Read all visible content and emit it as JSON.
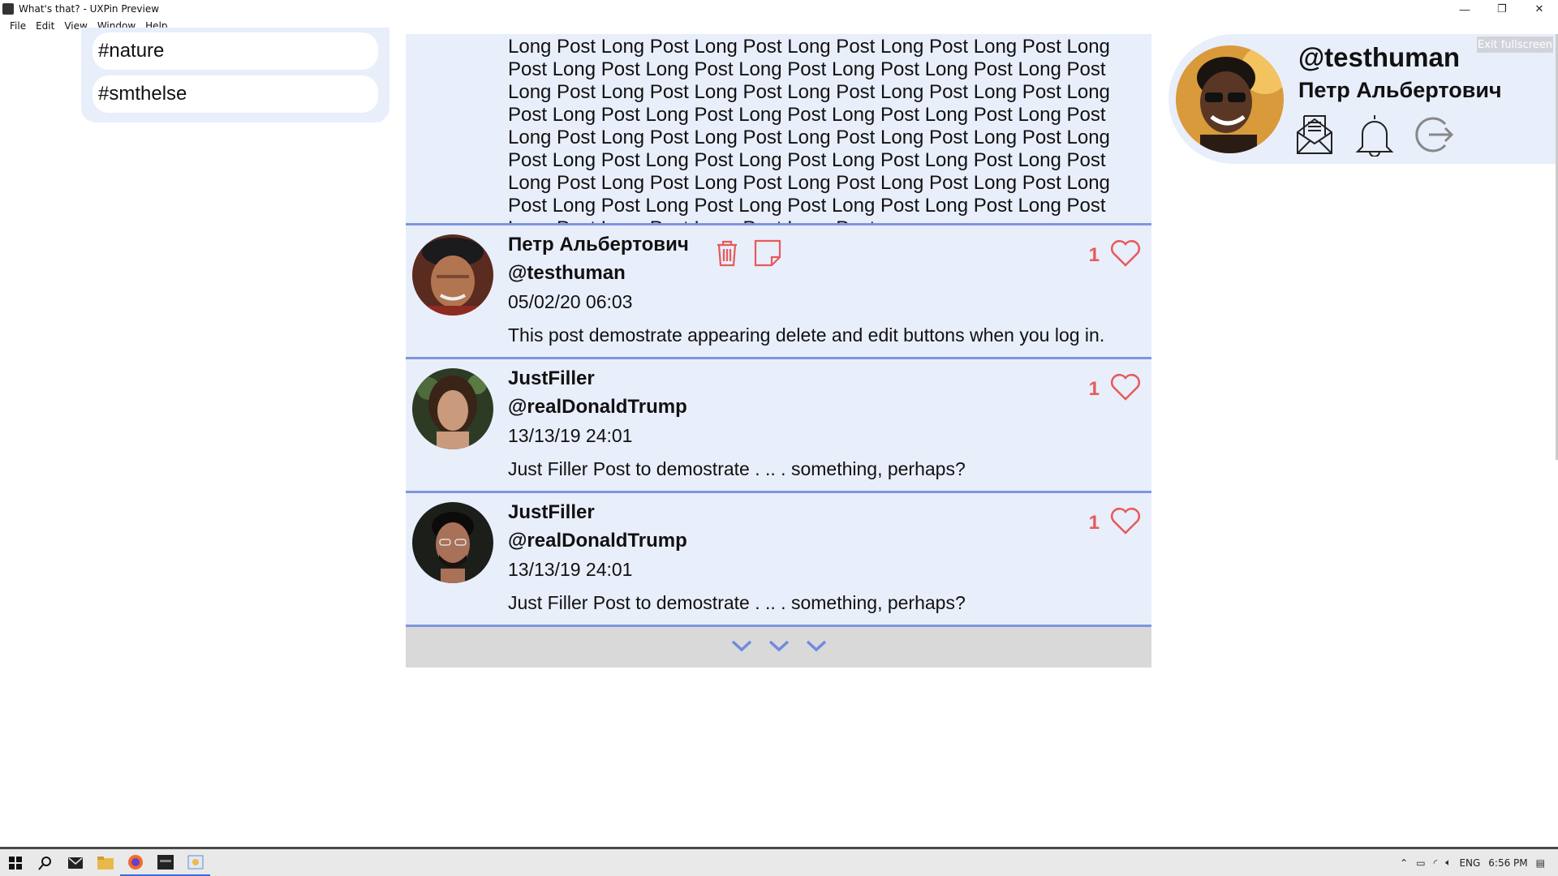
{
  "window": {
    "title": "What's that? - UXPin Preview",
    "controls": {
      "minimize": "—",
      "restore": "❐",
      "close": "✕"
    }
  },
  "menu": [
    "File",
    "Edit",
    "View",
    "Window",
    "Help"
  ],
  "tags": [
    "#nature",
    "#smthelse"
  ],
  "long_post": {
    "text": "Long Post Long Post Long Post Long Post Long Post Long Post Long Post Long Post Long Post Long Post Long Post Long Post Long Post Long Post Long Post Long Post Long Post Long Post Long Post Long Post Long Post Long Post Long Post Long Post Long Post Long Post Long Post Long Post Long Post Long Post Long Post Long Post Long Post Long Post Long Post Long Post Long Post Long Post Long Post Long Post Long Post Long Post Long Post Long Post Long Post Long Post Long Post Long Post Long Post Long Post Long Post Long Post Long Post Long Post Long Post Long Post"
  },
  "posts": [
    {
      "name": "Петр Альбертович",
      "handle": "@testhuman",
      "date": "05/02/20 06:03",
      "text": "This post demostrate appearing delete and edit buttons when you log in.",
      "likes": "1"
    },
    {
      "name": "JustFiller",
      "handle": "@realDonaldTrump",
      "date": "13/13/19 24:01",
      "text": "Just Filler Post to demostrate . .. . something, perhaps?",
      "likes": "1"
    },
    {
      "name": "JustFiller",
      "handle": "@realDonaldTrump",
      "date": "13/13/19 24:01",
      "text": "Just Filler Post to demostrate . .. . something, perhaps?",
      "likes": "1"
    }
  ],
  "profile": {
    "handle": "@testhuman",
    "name": "Петр Альбертович"
  },
  "exit_fullscreen": "Exit fullscreen",
  "tray": {
    "lang": "ENG",
    "time": "6:56 PM"
  },
  "colors": {
    "panel_bg": "#e9eefb",
    "divider": "#7e95e0",
    "like": "#e65a5a",
    "chevron": "#6f8ae0"
  }
}
